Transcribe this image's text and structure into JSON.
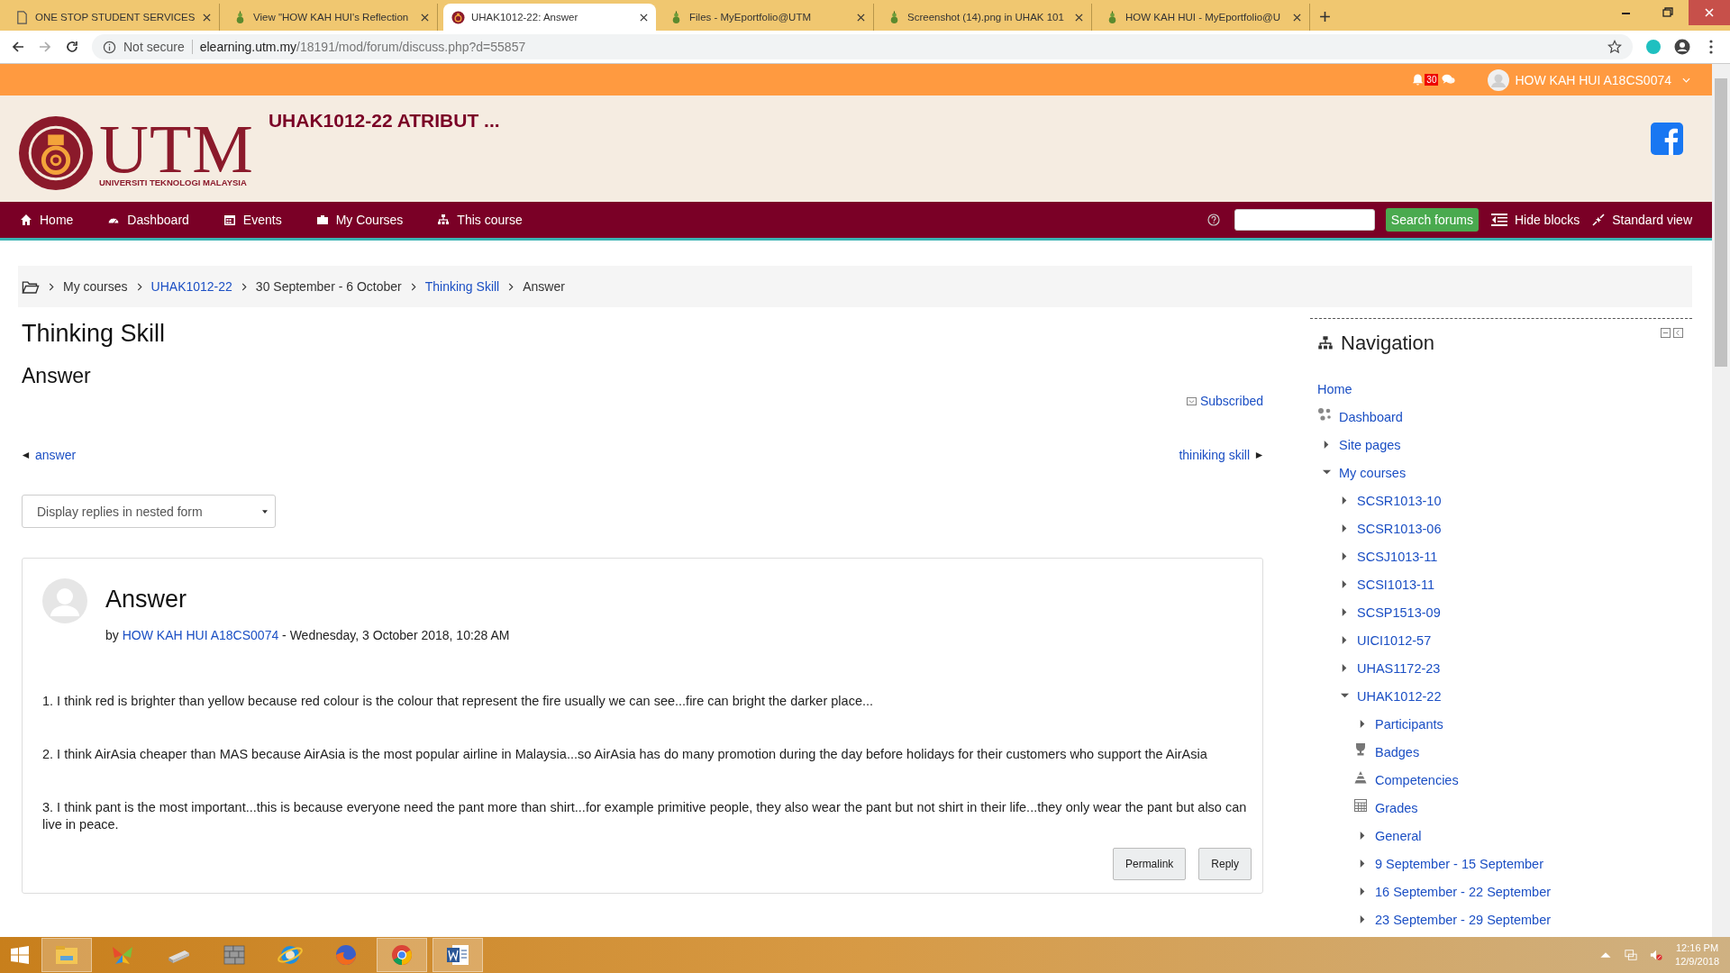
{
  "browser": {
    "tabs": [
      {
        "title": "ONE STOP STUDENT SERVICES",
        "kind": "page",
        "selected": false
      },
      {
        "title": "View \"HOW KAH HUI's Reflection",
        "kind": "portfolio",
        "selected": false
      },
      {
        "title": "UHAK1012-22: Answer",
        "kind": "course",
        "selected": true
      },
      {
        "title": "Files - MyEportfolio@UTM",
        "kind": "portfolio",
        "selected": false
      },
      {
        "title": "Screenshot (14).png in UHAK 101",
        "kind": "portfolio",
        "selected": false
      },
      {
        "title": "HOW KAH HUI - MyEportfolio@U",
        "kind": "portfolio",
        "selected": false
      }
    ],
    "security": "Not secure",
    "url_host": "elearning.utm.my",
    "url_path": "/18191/mod/forum/discuss.php?d=55857"
  },
  "top_bar": {
    "notification_count": "30",
    "user_name": "HOW KAH HUI A18CS0074"
  },
  "header": {
    "logo_text": "UTM",
    "logo_subtitle": "UNIVERSITI TEKNOLOGI MALAYSIA",
    "course_title": "UHAK1012-22 ATRIBUT ..."
  },
  "navbar": {
    "items": [
      "Home",
      "Dashboard",
      "Events",
      "My Courses",
      "This course"
    ],
    "search_button": "Search forums",
    "hide_blocks": "Hide blocks",
    "standard_view": "Standard view"
  },
  "breadcrumb": [
    {
      "label": "My courses",
      "link": false
    },
    {
      "label": "UHAK1012-22",
      "link": true
    },
    {
      "label": "30 September - 6 October",
      "link": false
    },
    {
      "label": "Thinking Skill",
      "link": true
    },
    {
      "label": "Answer",
      "link": false
    }
  ],
  "page": {
    "title": "Thinking Skill",
    "subtitle": "Answer",
    "subscribed": "Subscribed",
    "previous": "answer",
    "next": "thiniking skill",
    "display_mode": "Display replies in nested form"
  },
  "post": {
    "title": "Answer",
    "by": "by",
    "author": "HOW KAH HUI A18CS0074",
    "date": "- Wednesday, 3 October 2018, 10:28 AM",
    "paragraphs": [
      "1. I think red is brighter than yellow because red colour  is the colour that represent the fire usually we can see...fire can bright the darker place...",
      "2. I think AirAsia cheaper than MAS because AirAsia is the most popular airline in Malaysia...so AirAsia has do many promotion during the day before holidays for their customers who support the AirAsia",
      "3. I think pant is the most important...this is because everyone need the pant more than shirt...for example primitive people, they also wear the pant but not shirt in their life...they only wear the pant but also can live in peace."
    ],
    "buttons": [
      "Permalink",
      "Reply"
    ]
  },
  "navigation": {
    "title": "Navigation",
    "items": [
      {
        "label": "Home",
        "kind": "link"
      },
      {
        "label": "Dashboard",
        "kind": "dashboard"
      },
      {
        "label": "Site pages",
        "kind": "branch",
        "expanded": false
      },
      {
        "label": "My courses",
        "kind": "branch",
        "expanded": true,
        "children": [
          {
            "label": "SCSR1013-10",
            "kind": "branch",
            "expanded": false
          },
          {
            "label": "SCSR1013-06",
            "kind": "branch",
            "expanded": false
          },
          {
            "label": "SCSJ1013-11",
            "kind": "branch",
            "expanded": false
          },
          {
            "label": "SCSI1013-11",
            "kind": "branch",
            "expanded": false
          },
          {
            "label": "SCSP1513-09",
            "kind": "branch",
            "expanded": false
          },
          {
            "label": "UICI1012-57",
            "kind": "branch",
            "expanded": false
          },
          {
            "label": "UHAS1172-23",
            "kind": "branch",
            "expanded": false
          },
          {
            "label": "UHAK1012-22",
            "kind": "branch",
            "expanded": true,
            "children": [
              {
                "label": "Participants",
                "kind": "branch",
                "expanded": false
              },
              {
                "label": "Badges",
                "kind": "badges"
              },
              {
                "label": "Competencies",
                "kind": "competencies"
              },
              {
                "label": "Grades",
                "kind": "grades"
              },
              {
                "label": "General",
                "kind": "branch",
                "expanded": false
              },
              {
                "label": "9 September - 15 September",
                "kind": "branch",
                "expanded": false
              },
              {
                "label": "16 September - 22 September",
                "kind": "branch",
                "expanded": false
              },
              {
                "label": "23 September - 29 September",
                "kind": "branch",
                "expanded": false
              }
            ]
          }
        ]
      }
    ]
  },
  "taskbar": {
    "time": "12:16 PM",
    "date": "12/9/2018"
  }
}
